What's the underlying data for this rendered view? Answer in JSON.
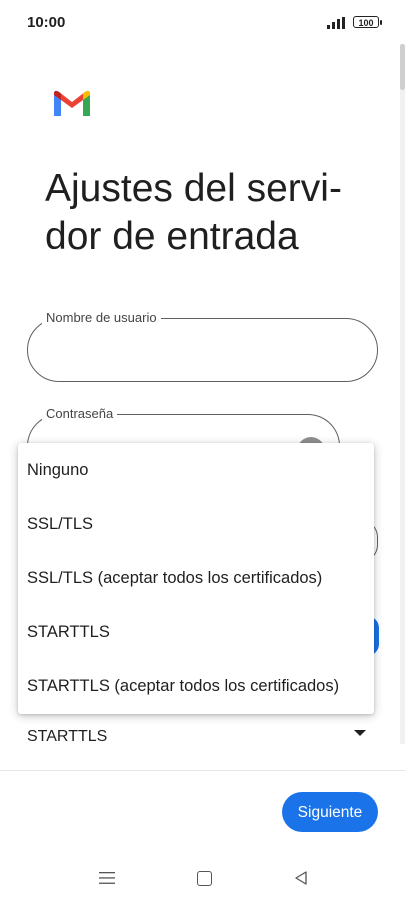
{
  "status_bar": {
    "time": "10:00",
    "battery": "100"
  },
  "header": {
    "title": "Ajustes del servi-dor de entrada"
  },
  "form": {
    "username": {
      "label": "Nombre de usuario",
      "value": ""
    },
    "password": {
      "label": "Contraseña",
      "value": ""
    },
    "security_type": {
      "selected": "STARTTLS"
    }
  },
  "dropdown": {
    "options": [
      "Ninguno",
      "SSL/TLS",
      "SSL/TLS (aceptar todos los certificados)",
      "STARTTLS",
      "STARTTLS (aceptar todos los certificados)"
    ]
  },
  "footer": {
    "next_label": "Siguiente"
  },
  "colors": {
    "accent": "#1a73e8",
    "text": "#1f1f1f"
  },
  "icons": [
    "signal-icon",
    "battery-icon",
    "gmail-logo",
    "eye-icon",
    "dropdown-caret-icon",
    "nav-menu-icon",
    "nav-home-icon",
    "nav-back-icon"
  ]
}
